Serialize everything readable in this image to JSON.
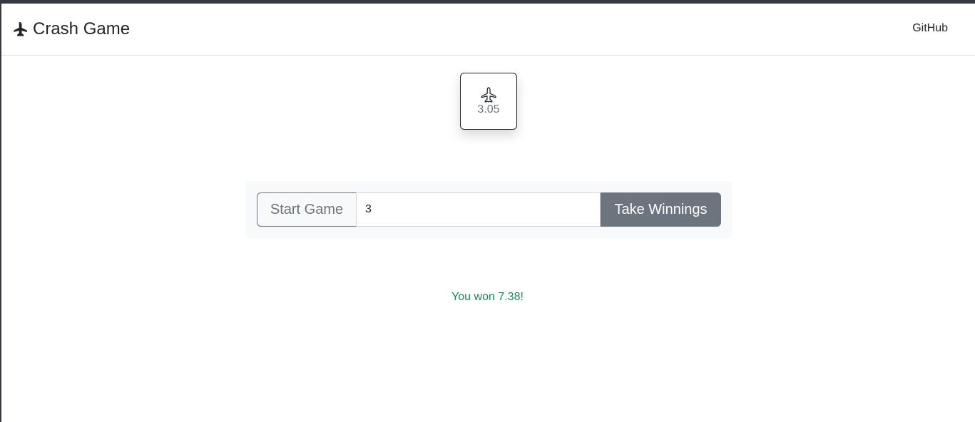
{
  "navbar": {
    "brand_label": "Crash Game",
    "brand_icon": "airplane-fill-icon",
    "github_label": "GitHub"
  },
  "game": {
    "multiplier_icon": "airplane-outline-icon",
    "multiplier": "3.05",
    "start_label": "Start Game",
    "bet_value": "3",
    "take_label": "Take Winnings",
    "result_message": "You won 7.38!"
  },
  "colors": {
    "accent_dark": "#343a40",
    "secondary": "#6c757d",
    "success": "#198754",
    "panel_bg": "#f8f9fa"
  }
}
